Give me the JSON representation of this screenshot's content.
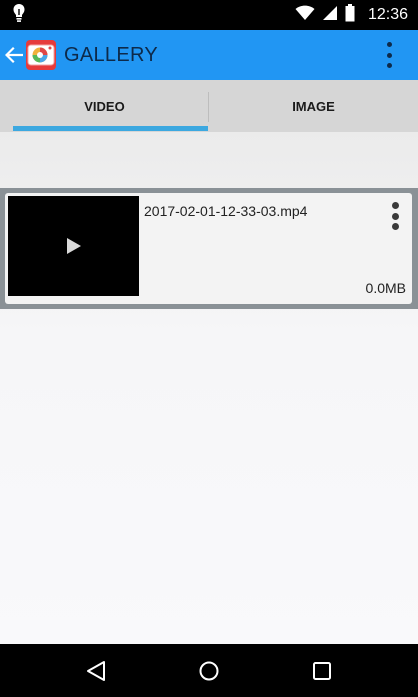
{
  "status_bar": {
    "time": "12:36",
    "icons": [
      "lightbulb-icon",
      "wifi-icon",
      "signal-icon",
      "battery-icon"
    ]
  },
  "app_bar": {
    "title": "GALLERY",
    "background_color": "#2196f3",
    "icons": [
      "back-arrow-icon",
      "app-logo-icon",
      "overflow-menu-icon"
    ]
  },
  "tabs": [
    {
      "label": "VIDEO",
      "selected": true
    },
    {
      "label": "IMAGE",
      "selected": false
    }
  ],
  "tab_indicator_color": "#3ca8e0",
  "videos": [
    {
      "file_name": "2017-02-01-12-33-03.mp4",
      "size": "0.0MB",
      "icons": [
        "play-icon",
        "more-options-icon"
      ]
    }
  ],
  "nav_bar": {
    "icons": [
      "back-icon",
      "home-icon",
      "recents-icon"
    ]
  }
}
